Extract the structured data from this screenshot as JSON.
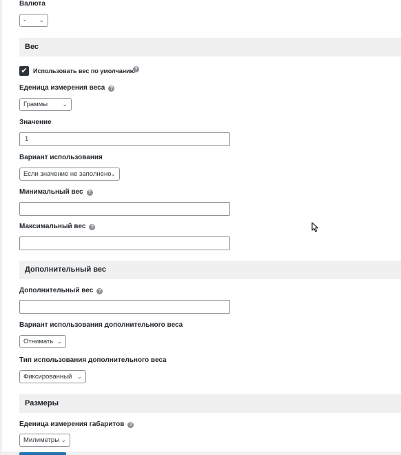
{
  "currency": {
    "label": "Валюта",
    "select_value": "-"
  },
  "weight_section": {
    "title": "Вес",
    "use_default_label": "Использовать вес по умолчанию",
    "use_default_checked": true,
    "unit_label": "Еденица измерения веса",
    "unit_value": "Граммы",
    "value_label": "Значение",
    "value_input": "1",
    "usage_label": "Вариант использования",
    "usage_value": "Если значение не заполнено",
    "min_label": "Минимальный вес",
    "min_value": "",
    "max_label": "Максимальный вес",
    "max_value": ""
  },
  "extra_weight_section": {
    "title": "Дополнительный вес",
    "extra_label": "Дополнительный вес",
    "extra_value": "",
    "usage_label": "Вариант использования дополнительного веса",
    "usage_value": "Отнимать",
    "type_label": "Тип использования дополнительного веса",
    "type_value": "Фиксированный"
  },
  "dimensions_section": {
    "title": "Размеры",
    "unit_label": "Еденица измерения габаритов",
    "unit_value": "Милиметры"
  },
  "help_glyph": "?",
  "chevron_glyph": "⌄",
  "check_glyph": "✔",
  "colors": {
    "section_bg": "#f0f0f1",
    "primary_button": "#2271b1",
    "checkbox": "#2c3338"
  }
}
